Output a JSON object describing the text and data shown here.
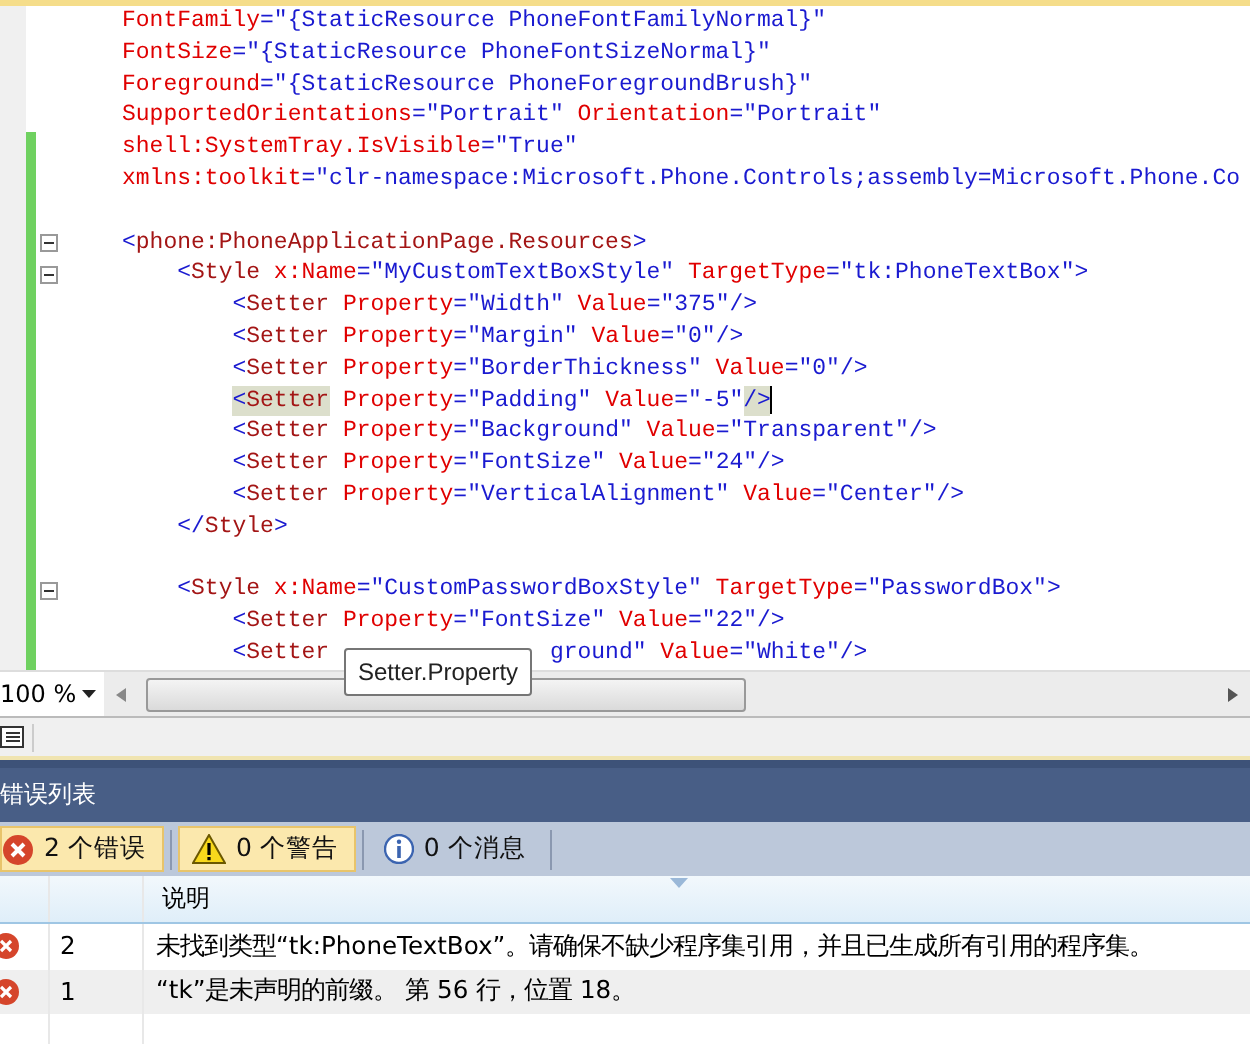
{
  "editor": {
    "lines": [
      {
        "changed": false,
        "fold": false,
        "cursor": false,
        "tokens": [
          {
            "kind": "attr",
            "text": "FontFamily"
          },
          {
            "kind": "punct",
            "text": "="
          },
          {
            "kind": "value",
            "text": "\"{StaticResource PhoneFontFamilyNormal}\""
          }
        ]
      },
      {
        "changed": false,
        "fold": false,
        "cursor": false,
        "tokens": [
          {
            "kind": "attr",
            "text": "FontSize"
          },
          {
            "kind": "punct",
            "text": "="
          },
          {
            "kind": "value",
            "text": "\"{StaticResource PhoneFontSizeNormal}\""
          }
        ]
      },
      {
        "changed": false,
        "fold": false,
        "cursor": false,
        "tokens": [
          {
            "kind": "attr",
            "text": "Foreground"
          },
          {
            "kind": "punct",
            "text": "="
          },
          {
            "kind": "value",
            "text": "\"{StaticResource PhoneForegroundBrush}\""
          }
        ]
      },
      {
        "changed": false,
        "fold": false,
        "cursor": false,
        "tokens": [
          {
            "kind": "attr",
            "text": "SupportedOrientations"
          },
          {
            "kind": "punct",
            "text": "="
          },
          {
            "kind": "value",
            "text": "\"Portrait\""
          },
          {
            "kind": "attr",
            "text": " Orientation"
          },
          {
            "kind": "punct",
            "text": "="
          },
          {
            "kind": "value",
            "text": "\"Portrait\""
          }
        ]
      },
      {
        "changed": true,
        "fold": false,
        "cursor": false,
        "tokens": [
          {
            "kind": "attr",
            "text": "shell:SystemTray.IsVisible"
          },
          {
            "kind": "punct",
            "text": "="
          },
          {
            "kind": "value",
            "text": "\"True\""
          }
        ]
      },
      {
        "changed": true,
        "fold": false,
        "cursor": false,
        "tokens": [
          {
            "kind": "attr",
            "text": "xmlns:toolkit"
          },
          {
            "kind": "punct",
            "text": "="
          },
          {
            "kind": "value",
            "text": "\"clr-namespace:Microsoft.Phone.Controls;assembly=Microsoft.Phone.Co"
          }
        ]
      },
      {
        "changed": true,
        "fold": false,
        "cursor": false
      },
      {
        "changed": true,
        "fold": true,
        "cursor": false,
        "tokens": [
          {
            "kind": "punct",
            "text": "<"
          },
          {
            "kind": "element",
            "text": "phone:PhoneApplicationPage.Resources"
          },
          {
            "kind": "punct",
            "text": ">"
          }
        ]
      },
      {
        "changed": true,
        "fold": true,
        "cursor": false,
        "tokens": [
          {
            "kind": "punct",
            "text": "    <"
          },
          {
            "kind": "element",
            "text": "Style"
          },
          {
            "kind": "attr",
            "text": " x:Name"
          },
          {
            "kind": "punct",
            "text": "="
          },
          {
            "kind": "value",
            "text": "\"MyCustomTextBoxStyle\""
          },
          {
            "kind": "attr",
            "text": " TargetType"
          },
          {
            "kind": "punct",
            "text": "="
          },
          {
            "kind": "value",
            "text": "\"tk:PhoneTextBox\""
          },
          {
            "kind": "punct",
            "text": ">"
          }
        ]
      },
      {
        "changed": true,
        "fold": false,
        "cursor": false,
        "tokens": [
          {
            "kind": "punct",
            "text": "        <"
          },
          {
            "kind": "element",
            "text": "Setter"
          },
          {
            "kind": "attr",
            "text": " Property"
          },
          {
            "kind": "punct",
            "text": "="
          },
          {
            "kind": "value",
            "text": "\"Width\""
          },
          {
            "kind": "attr",
            "text": " Value"
          },
          {
            "kind": "punct",
            "text": "="
          },
          {
            "kind": "value",
            "text": "\"375\""
          },
          {
            "kind": "punct",
            "text": "/>"
          }
        ]
      },
      {
        "changed": true,
        "fold": false,
        "cursor": false,
        "tokens": [
          {
            "kind": "punct",
            "text": "        <"
          },
          {
            "kind": "element",
            "text": "Setter"
          },
          {
            "kind": "attr",
            "text": " Property"
          },
          {
            "kind": "punct",
            "text": "="
          },
          {
            "kind": "value",
            "text": "\"Margin\""
          },
          {
            "kind": "attr",
            "text": " Value"
          },
          {
            "kind": "punct",
            "text": "="
          },
          {
            "kind": "value",
            "text": "\"0\""
          },
          {
            "kind": "punct",
            "text": "/>"
          }
        ]
      },
      {
        "changed": true,
        "fold": false,
        "cursor": false,
        "tokens": [
          {
            "kind": "punct",
            "text": "        <"
          },
          {
            "kind": "element",
            "text": "Setter"
          },
          {
            "kind": "attr",
            "text": " Property"
          },
          {
            "kind": "punct",
            "text": "="
          },
          {
            "kind": "value",
            "text": "\"BorderThickness\""
          },
          {
            "kind": "attr",
            "text": " Value"
          },
          {
            "kind": "punct",
            "text": "="
          },
          {
            "kind": "value",
            "text": "\"0\""
          },
          {
            "kind": "punct",
            "text": "/>"
          }
        ]
      },
      {
        "changed": true,
        "fold": false,
        "cursor": true,
        "tokens": [
          {
            "kind": "hl_punct",
            "text": "        <"
          },
          {
            "kind": "hl_element",
            "text": "Setter"
          },
          {
            "kind": "attr",
            "text": " Property"
          },
          {
            "kind": "punct",
            "text": "="
          },
          {
            "kind": "value",
            "text": "\"Padding\""
          },
          {
            "kind": "attr",
            "text": " Value"
          },
          {
            "kind": "punct",
            "text": "="
          },
          {
            "kind": "value",
            "text": "\"-5\""
          },
          {
            "kind": "hl_punct",
            "text": "/>"
          }
        ]
      },
      {
        "changed": true,
        "fold": false,
        "cursor": false,
        "tokens": [
          {
            "kind": "punct",
            "text": "        <"
          },
          {
            "kind": "element",
            "text": "Setter"
          },
          {
            "kind": "attr",
            "text": " Property"
          },
          {
            "kind": "punct",
            "text": "="
          },
          {
            "kind": "value",
            "text": "\"Background\""
          },
          {
            "kind": "attr",
            "text": " Value"
          },
          {
            "kind": "punct",
            "text": "="
          },
          {
            "kind": "value",
            "text": "\"Transparent\""
          },
          {
            "kind": "punct",
            "text": "/>"
          }
        ]
      },
      {
        "changed": true,
        "fold": false,
        "cursor": false,
        "tokens": [
          {
            "kind": "punct",
            "text": "        <"
          },
          {
            "kind": "element",
            "text": "Setter"
          },
          {
            "kind": "attr",
            "text": " Property"
          },
          {
            "kind": "punct",
            "text": "="
          },
          {
            "kind": "value",
            "text": "\"FontSize\""
          },
          {
            "kind": "attr",
            "text": " Value"
          },
          {
            "kind": "punct",
            "text": "="
          },
          {
            "kind": "value",
            "text": "\"24\""
          },
          {
            "kind": "punct",
            "text": "/>"
          }
        ]
      },
      {
        "changed": true,
        "fold": false,
        "cursor": false,
        "tokens": [
          {
            "kind": "punct",
            "text": "        <"
          },
          {
            "kind": "element",
            "text": "Setter"
          },
          {
            "kind": "attr",
            "text": " Property"
          },
          {
            "kind": "punct",
            "text": "="
          },
          {
            "kind": "value",
            "text": "\"VerticalAlignment\""
          },
          {
            "kind": "attr",
            "text": " Value"
          },
          {
            "kind": "punct",
            "text": "="
          },
          {
            "kind": "value",
            "text": "\"Center\""
          },
          {
            "kind": "punct",
            "text": "/>"
          }
        ]
      },
      {
        "changed": true,
        "fold": false,
        "cursor": false,
        "tokens": [
          {
            "kind": "punct",
            "text": "    </"
          },
          {
            "kind": "element",
            "text": "Style"
          },
          {
            "kind": "punct",
            "text": ">"
          }
        ]
      },
      {
        "changed": true,
        "fold": false,
        "cursor": false
      },
      {
        "changed": true,
        "fold": true,
        "cursor": false,
        "tokens": [
          {
            "kind": "punct",
            "text": "    <"
          },
          {
            "kind": "element",
            "text": "Style"
          },
          {
            "kind": "attr",
            "text": " x:Name"
          },
          {
            "kind": "punct",
            "text": "="
          },
          {
            "kind": "value",
            "text": "\"CustomPasswordBoxStyle\""
          },
          {
            "kind": "attr",
            "text": " TargetType"
          },
          {
            "kind": "punct",
            "text": "="
          },
          {
            "kind": "value",
            "text": "\"PasswordBox\""
          },
          {
            "kind": "punct",
            "text": ">"
          }
        ]
      },
      {
        "changed": true,
        "fold": false,
        "cursor": false,
        "tokens": [
          {
            "kind": "punct",
            "text": "        <"
          },
          {
            "kind": "element",
            "text": "Setter"
          },
          {
            "kind": "attr",
            "text": " Property"
          },
          {
            "kind": "punct",
            "text": "="
          },
          {
            "kind": "value",
            "text": "\"FontSize\""
          },
          {
            "kind": "attr",
            "text": " Value"
          },
          {
            "kind": "punct",
            "text": "="
          },
          {
            "kind": "value",
            "text": "\"22\""
          },
          {
            "kind": "punct",
            "text": "/>"
          }
        ]
      },
      {
        "changed": true,
        "fold": false,
        "cursor": false,
        "tokens": [
          {
            "kind": "punct",
            "text": "        <"
          },
          {
            "kind": "element",
            "text": "Setter"
          },
          {
            "kind": "gap"
          },
          {
            "kind": "value",
            "text": "ground\""
          },
          {
            "kind": "attr",
            "text": " Value"
          },
          {
            "kind": "punct",
            "text": "="
          },
          {
            "kind": "value",
            "text": "\"White\""
          },
          {
            "kind": "punct",
            "text": "/>"
          }
        ]
      }
    ]
  },
  "tooltip": "Setter.Property",
  "zoom": "100 %",
  "error_list": {
    "title": "错误列表",
    "filters": [
      {
        "kind": "error",
        "label": "2 个错误",
        "selected": true
      },
      {
        "kind": "warning",
        "label": "0 个警告",
        "selected": true
      },
      {
        "kind": "info",
        "label": "0 个消息",
        "selected": false
      }
    ],
    "columns": [
      "说明"
    ],
    "rows": [
      {
        "kind": "error",
        "number": "2",
        "description": "未找到类型“tk:PhoneTextBox”。请确保不缺少程序集引用，并且已生成所有引用的程序集。"
      },
      {
        "kind": "error",
        "number": "1",
        "description": "“tk”是未声明的前缀。 第 56 行，位置 18。"
      }
    ]
  }
}
